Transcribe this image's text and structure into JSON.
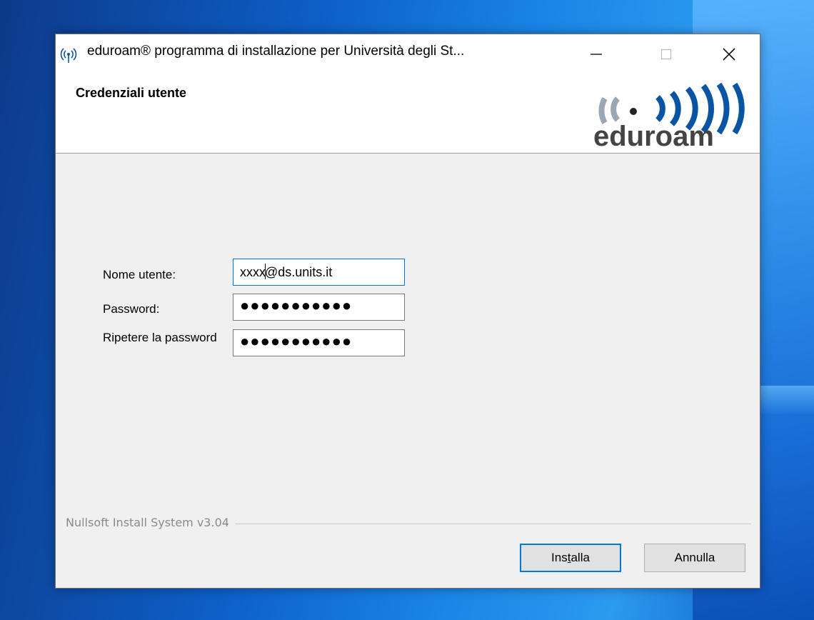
{
  "window": {
    "title": "eduroam® programma di installazione per Università degli St...",
    "header_title": "Credenziali utente",
    "logo_text": "eduroam"
  },
  "form": {
    "username_label": "Nome utente:",
    "username_value": "xxxx@ds.units.it",
    "username_value_before_caret": "xxxx",
    "username_value_after_caret": "@ds.units.it",
    "password_label": "Password:",
    "password_value": "●●●●●●●●●●●",
    "repeat_label": "Ripetere la password",
    "repeat_value": "●●●●●●●●●●●"
  },
  "footer": {
    "brand": "Nullsoft Install System v3.04",
    "install_label_pre": "Ins",
    "install_label_underlined": "t",
    "install_label_post": "alla",
    "cancel_label": "Annulla"
  },
  "colors": {
    "focus_blue": "#0078d7",
    "logo_gray": "#9aa7b5",
    "logo_blue": "#0a55a3",
    "desktop_blue": "#1a86e6"
  },
  "icons": [
    "eduroam-signal-icon",
    "minimize-icon",
    "maximize-icon",
    "close-icon"
  ]
}
